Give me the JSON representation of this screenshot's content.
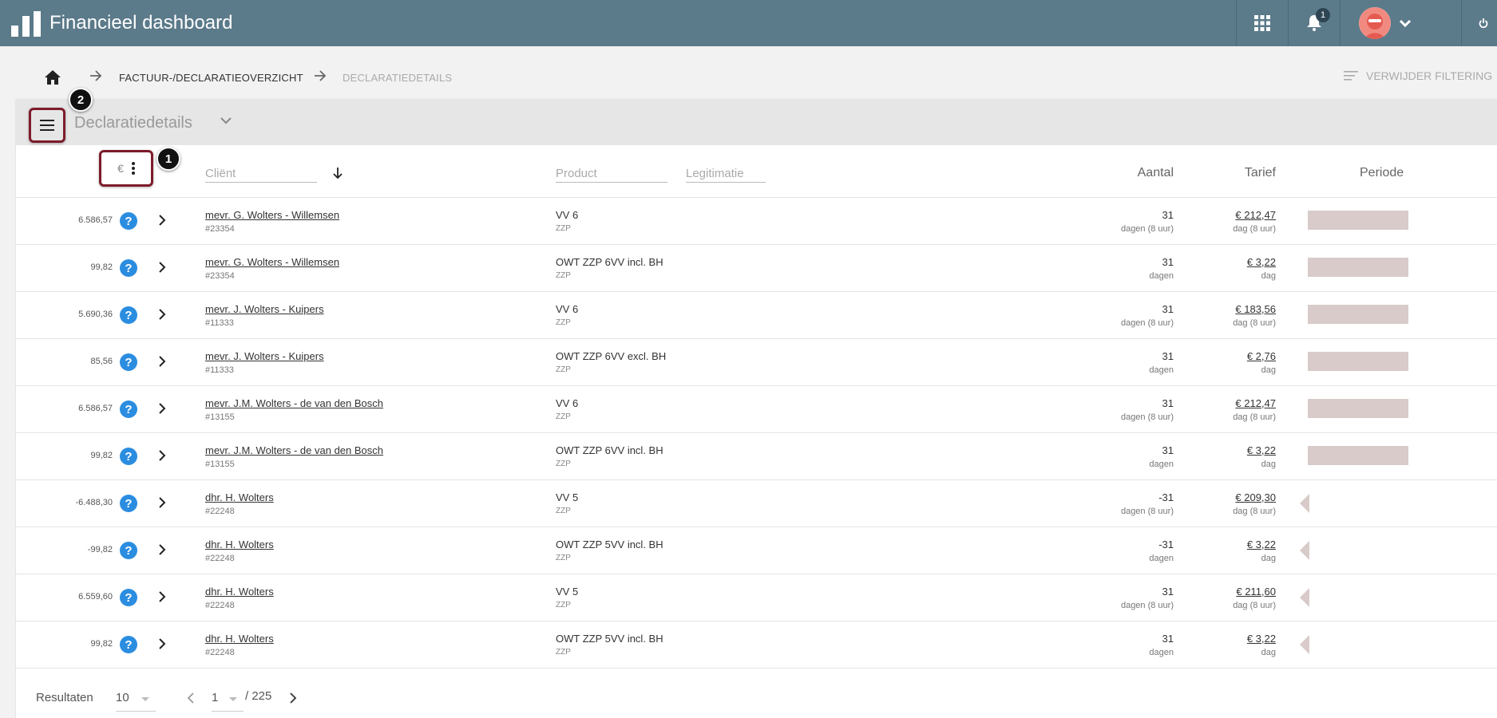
{
  "app": {
    "title": "Financieel dashboard",
    "notification_count": "1"
  },
  "breadcrumb": {
    "items": [
      "FACTUUR-/DECLARATIEOVERZICHT",
      "DECLARATIEDETAILS"
    ],
    "clear_filter_label": "VERWIJDER FILTERING"
  },
  "panel": {
    "title": "Declaratiedetails"
  },
  "callouts": [
    "1",
    "2"
  ],
  "table": {
    "currency_symbol": "€",
    "filters": {
      "client": "Cliënt",
      "product": "Product",
      "legitimatie": "Legitimatie"
    },
    "headers": {
      "aantal": "Aantal",
      "tarief": "Tarief",
      "periode": "Periode"
    },
    "rows": [
      {
        "amount": "6.586,57",
        "client": "mevr. G. Wolters - Willemsen",
        "client_id": "#23354",
        "product": "VV 6",
        "product_sub": "ZZP",
        "aantal": "31",
        "aantal_unit": "dagen (8 uur)",
        "tarief": "€ 212,47",
        "tarief_unit": "dag (8 uur)",
        "period": "bar"
      },
      {
        "amount": "99,82",
        "client": "mevr. G. Wolters - Willemsen",
        "client_id": "#23354",
        "product": "OWT ZZP 6VV incl. BH",
        "product_sub": "ZZP",
        "aantal": "31",
        "aantal_unit": "dagen",
        "tarief": "€ 3,22",
        "tarief_unit": "dag",
        "period": "bar"
      },
      {
        "amount": "5.690,36",
        "client": "mevr. J. Wolters - Kuipers",
        "client_id": "#11333",
        "product": "VV 6",
        "product_sub": "ZZP",
        "aantal": "31",
        "aantal_unit": "dagen (8 uur)",
        "tarief": "€ 183,56",
        "tarief_unit": "dag (8 uur)",
        "period": "bar"
      },
      {
        "amount": "85,56",
        "client": "mevr. J. Wolters - Kuipers",
        "client_id": "#11333",
        "product": "OWT ZZP 6VV excl. BH",
        "product_sub": "ZZP",
        "aantal": "31",
        "aantal_unit": "dagen",
        "tarief": "€ 2,76",
        "tarief_unit": "dag",
        "period": "bar"
      },
      {
        "amount": "6.586,57",
        "client": "mevr. J.M. Wolters - de van den Bosch",
        "client_id": "#13155",
        "product": "VV 6",
        "product_sub": "ZZP",
        "aantal": "31",
        "aantal_unit": "dagen (8 uur)",
        "tarief": "€ 212,47",
        "tarief_unit": "dag (8 uur)",
        "period": "bar"
      },
      {
        "amount": "99,82",
        "client": "mevr. J.M. Wolters - de van den Bosch",
        "client_id": "#13155",
        "product": "OWT ZZP 6VV incl. BH",
        "product_sub": "ZZP",
        "aantal": "31",
        "aantal_unit": "dagen",
        "tarief": "€ 3,22",
        "tarief_unit": "dag",
        "period": "bar"
      },
      {
        "amount": "-6.488,30",
        "client": "dhr. H. Wolters",
        "client_id": "#22248",
        "product": "VV 5",
        "product_sub": "ZZP",
        "aantal": "-31",
        "aantal_unit": "dagen (8 uur)",
        "tarief": "€ 209,30",
        "tarief_unit": "dag (8 uur)",
        "period": "arrow"
      },
      {
        "amount": "-99,82",
        "client": "dhr. H. Wolters",
        "client_id": "#22248",
        "product": "OWT ZZP 5VV incl. BH",
        "product_sub": "ZZP",
        "aantal": "-31",
        "aantal_unit": "dagen",
        "tarief": "€ 3,22",
        "tarief_unit": "dag",
        "period": "arrow"
      },
      {
        "amount": "6.559,60",
        "client": "dhr. H. Wolters",
        "client_id": "#22248",
        "product": "VV 5",
        "product_sub": "ZZP",
        "aantal": "31",
        "aantal_unit": "dagen (8 uur)",
        "tarief": "€ 211,60",
        "tarief_unit": "dag (8 uur)",
        "period": "arrow"
      },
      {
        "amount": "99,82",
        "client": "dhr. H. Wolters",
        "client_id": "#22248",
        "product": "OWT ZZP 5VV incl. BH",
        "product_sub": "ZZP",
        "aantal": "31",
        "aantal_unit": "dagen",
        "tarief": "€ 3,22",
        "tarief_unit": "dag",
        "period": "arrow"
      }
    ]
  },
  "footer": {
    "results_label": "Resultaten",
    "results_per_page": "10",
    "page": "1",
    "total_pages": "/ 225"
  },
  "colors": {
    "topbar": "#5b7a8a",
    "highlight_border": "#7d1b2a",
    "help_icon": "#2b8de0",
    "period_bar": "#d8cbca"
  }
}
